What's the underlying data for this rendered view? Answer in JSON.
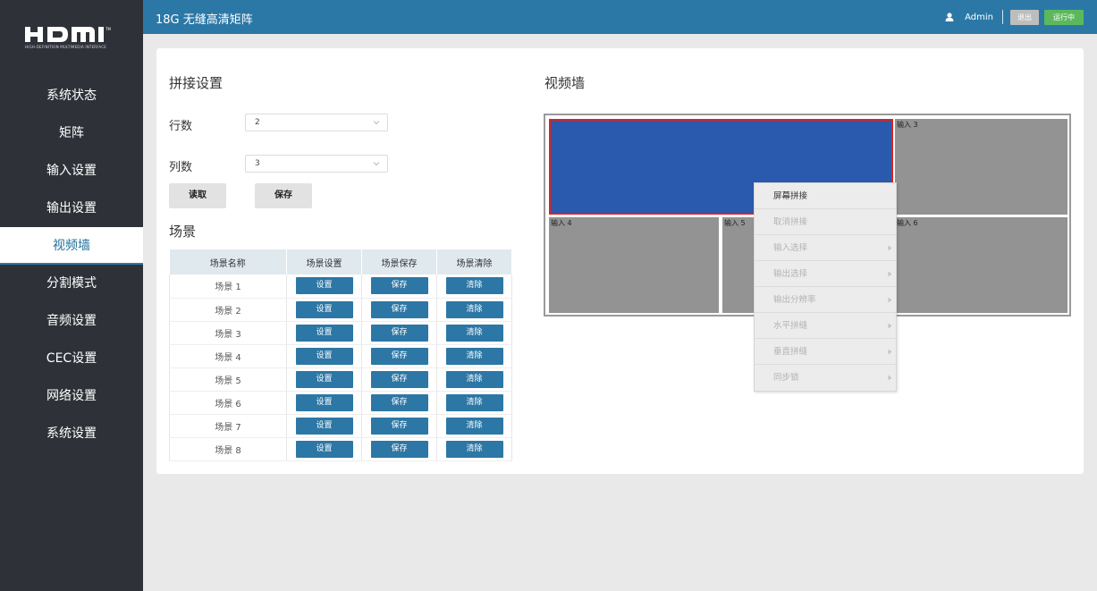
{
  "app": {
    "logo_text": "HDMI",
    "logo_sub": "HIGH-DEFINITION MULTIMEDIA INTERFACE",
    "title": "18G 无缝高清矩阵"
  },
  "user": {
    "name": "Admin",
    "logout_label": "退出",
    "status_label": "运行中"
  },
  "sidebar": {
    "items": [
      {
        "label": "系统状态"
      },
      {
        "label": "矩阵"
      },
      {
        "label": "输入设置"
      },
      {
        "label": "输出设置"
      },
      {
        "label": "视频墙",
        "active": true
      },
      {
        "label": "分割模式"
      },
      {
        "label": "音频设置"
      },
      {
        "label": "CEC设置"
      },
      {
        "label": "网络设置"
      },
      {
        "label": "系统设置"
      }
    ]
  },
  "splice": {
    "title": "拼接设置",
    "rows_label": "行数",
    "rows_value": "2",
    "cols_label": "列数",
    "cols_value": "3",
    "read_label": "读取",
    "save_label": "保存"
  },
  "scene": {
    "title": "场景",
    "headers": [
      "场景名称",
      "场景设置",
      "场景保存",
      "场景清除"
    ],
    "rows": [
      {
        "name": "场景 1"
      },
      {
        "name": "场景 2"
      },
      {
        "name": "场景 3"
      },
      {
        "name": "场景 4"
      },
      {
        "name": "场景 5"
      },
      {
        "name": "场景 6"
      },
      {
        "name": "场景 7"
      },
      {
        "name": "场景 8"
      }
    ],
    "set_label": "设置",
    "save_label": "保存",
    "clear_label": "清除"
  },
  "wall": {
    "title": "视频墙",
    "cells": {
      "input3": "输入 3",
      "input4": "输入 4",
      "input5": "输入 5",
      "input6": "输入 6"
    }
  },
  "context_menu": {
    "items": [
      {
        "label": "屏幕拼接",
        "enabled": true,
        "submenu": false
      },
      {
        "label": "取消拼接",
        "enabled": false,
        "submenu": false
      },
      {
        "label": "输入选择",
        "enabled": false,
        "submenu": true
      },
      {
        "label": "输出选择",
        "enabled": false,
        "submenu": true
      },
      {
        "label": "输出分辨率",
        "enabled": false,
        "submenu": true
      },
      {
        "label": "水平拼缝",
        "enabled": false,
        "submenu": true
      },
      {
        "label": "垂直拼缝",
        "enabled": false,
        "submenu": true
      },
      {
        "label": "同步锁",
        "enabled": false,
        "submenu": true
      }
    ]
  },
  "colors": {
    "topbar": "#2b78a7",
    "sidebar": "#2e3238",
    "button_blue": "#2c77a5",
    "merged_block": "#2a5aad",
    "selection_border": "#e02020",
    "status_green": "#5cb85c"
  }
}
